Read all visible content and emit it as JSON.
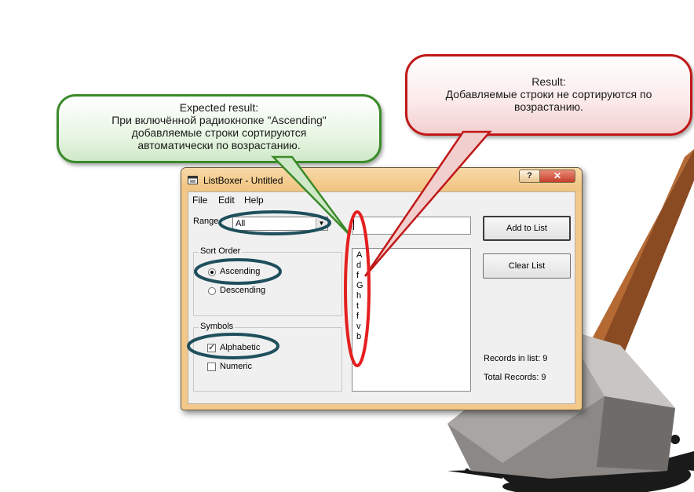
{
  "callouts": {
    "expected": {
      "heading": "Expected result:",
      "lines": [
        "При включённой радиокнопке \"Ascending\"",
        "добавляемые строки сортируются",
        "автоматически по возрастанию."
      ]
    },
    "actual": {
      "heading": "Result:",
      "lines": [
        "Добавляемые строки не сортируются по",
        "возрастанию."
      ]
    }
  },
  "window": {
    "title": "ListBoxer - Untitled",
    "help_button": "?",
    "close_button": "✕"
  },
  "menu": [
    "File",
    "Edit",
    "Help"
  ],
  "range": {
    "label": "Range",
    "value": "All"
  },
  "sort_order": {
    "title": "Sort Order",
    "options": [
      {
        "label": "Ascending",
        "selected": true
      },
      {
        "label": "Descending",
        "selected": false
      }
    ]
  },
  "symbols": {
    "title": "Symbols",
    "options": [
      {
        "label": "Alphabetic",
        "checked": true
      },
      {
        "label": "Numeric",
        "checked": false
      }
    ]
  },
  "entry": {
    "value": ""
  },
  "list_items": [
    "A",
    "d",
    "f",
    "G",
    "h",
    "t",
    "f",
    "v",
    "b"
  ],
  "buttons": {
    "add": "Add to List",
    "clear": "Clear List"
  },
  "stats": {
    "records_in_list": "Records in list: 9",
    "total_records": "Total Records: 9"
  },
  "colors": {
    "green_callout": "#3a8a2a",
    "red_callout": "#c01818",
    "highlight_ring": "#1f4f5c"
  },
  "icons": [
    "app-icon",
    "help-icon",
    "close-icon",
    "dropdown-arrow-icon",
    "checkmark-icon"
  ]
}
